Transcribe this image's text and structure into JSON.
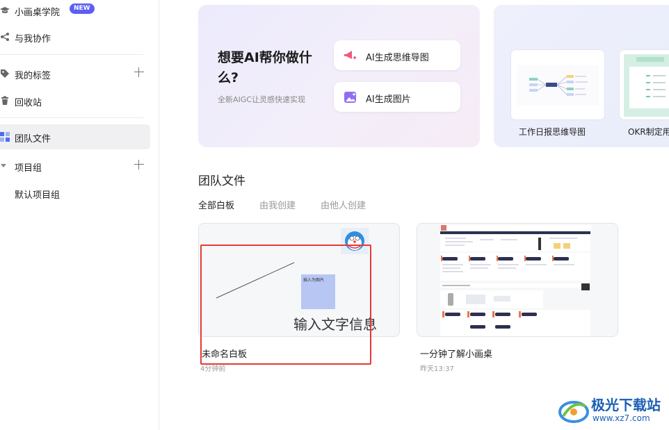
{
  "sidebar": {
    "items": [
      {
        "label": "小画桌学院",
        "badge": "NEW"
      },
      {
        "label": "与我协作"
      },
      {
        "label": "我的标签"
      },
      {
        "label": "回收站"
      },
      {
        "label": "团队文件"
      },
      {
        "label": "项目组"
      },
      {
        "label": "默认项目组"
      }
    ]
  },
  "banner": {
    "title": "想要AI帮你做什么?",
    "subtitle": "全新AIGC让灵感快速实现",
    "buttons": [
      {
        "label": "AI生成思维导图",
        "icon": "megaphone-sparkle-icon"
      },
      {
        "label": "AI生成图片",
        "icon": "image-sparkle-icon"
      }
    ]
  },
  "templates": [
    {
      "label": "工作日报思维导图"
    },
    {
      "label": "OKR制定用"
    }
  ],
  "team_files": {
    "title": "团队文件",
    "tabs": [
      "全部白板",
      "由我创建",
      "由他人创建"
    ],
    "files": [
      {
        "name": "未命名白板",
        "time": "4分钟前",
        "preview_note": "插入为图片",
        "preview_text": "输入文字信息"
      },
      {
        "name": "一分钟了解小画桌",
        "time": "昨天13:37"
      }
    ]
  },
  "watermark": {
    "title": "极光下载站",
    "url": "www.xz7.com"
  },
  "colors": {
    "accent": "#5b5ff5",
    "highlight_box": "#e53935",
    "active_bg": "#f0f0f2"
  }
}
